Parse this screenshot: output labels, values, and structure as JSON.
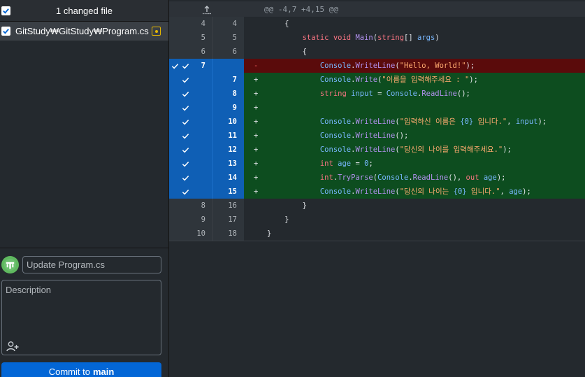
{
  "changes": {
    "header_label": "1 changed file"
  },
  "files": [
    {
      "path": "GitStudy₩GitStudy₩Program.cs",
      "status": "modified"
    }
  ],
  "commit": {
    "summary_placeholder": "Update Program.cs",
    "description_placeholder": "Description",
    "button_prefix": "Commit to",
    "branch": "main"
  },
  "diff": {
    "hunk_header": "@@ -4,7 +4,15 @@",
    "lines": [
      {
        "type": "ctx",
        "old": "4",
        "new": "4",
        "sign": "",
        "code": "    {"
      },
      {
        "type": "ctx",
        "old": "5",
        "new": "5",
        "sign": "",
        "code": "        static void Main(string[] args)"
      },
      {
        "type": "ctx",
        "old": "6",
        "new": "6",
        "sign": "",
        "code": "        {"
      },
      {
        "type": "del",
        "old": "7",
        "new": "",
        "sign": "-",
        "code": "            Console.WriteLine(\"Hello, World!\");"
      },
      {
        "type": "add",
        "old": "",
        "new": "7",
        "sign": "+",
        "code": "            Console.Write(\"이름을 입력해주세요 : \");"
      },
      {
        "type": "add",
        "old": "",
        "new": "8",
        "sign": "+",
        "code": "            string input = Console.ReadLine();"
      },
      {
        "type": "add",
        "old": "",
        "new": "9",
        "sign": "+",
        "code": ""
      },
      {
        "type": "add",
        "old": "",
        "new": "10",
        "sign": "+",
        "code": "            Console.WriteLine(\"입력하신 이름은 {0} 입니다.\", input);"
      },
      {
        "type": "add",
        "old": "",
        "new": "11",
        "sign": "+",
        "code": "            Console.WriteLine();"
      },
      {
        "type": "add",
        "old": "",
        "new": "12",
        "sign": "+",
        "code": "            Console.WriteLine(\"당신의 나이를 입력해주세요.\");"
      },
      {
        "type": "add",
        "old": "",
        "new": "13",
        "sign": "+",
        "code": "            int age = 0;"
      },
      {
        "type": "add",
        "old": "",
        "new": "14",
        "sign": "+",
        "code": "            int.TryParse(Console.ReadLine(), out age);"
      },
      {
        "type": "add",
        "old": "",
        "new": "15",
        "sign": "+",
        "code": "            Console.WriteLine(\"당신의 나이는 {0} 입니다.\", age);"
      },
      {
        "type": "ctx",
        "old": "8",
        "new": "16",
        "sign": "",
        "code": "        }"
      },
      {
        "type": "ctx",
        "old": "9",
        "new": "17",
        "sign": "",
        "code": "    }"
      },
      {
        "type": "ctx",
        "old": "10",
        "new": "18",
        "sign": "",
        "code": "}"
      }
    ]
  },
  "icons": {
    "checkbox": "checkbox-checked-icon",
    "modified": "file-modified-icon",
    "expand": "expand-up-icon",
    "avatar": "user-avatar",
    "coauthor": "add-coauthor-icon",
    "line_check": "line-selected-check-icon"
  },
  "colors": {
    "accent": "#0366d6",
    "selection_gutter": "#0f5fb5",
    "added_bg": "#0d4d1f",
    "deleted_bg": "#5a0b0b",
    "modified_badge": "#e5b700"
  }
}
